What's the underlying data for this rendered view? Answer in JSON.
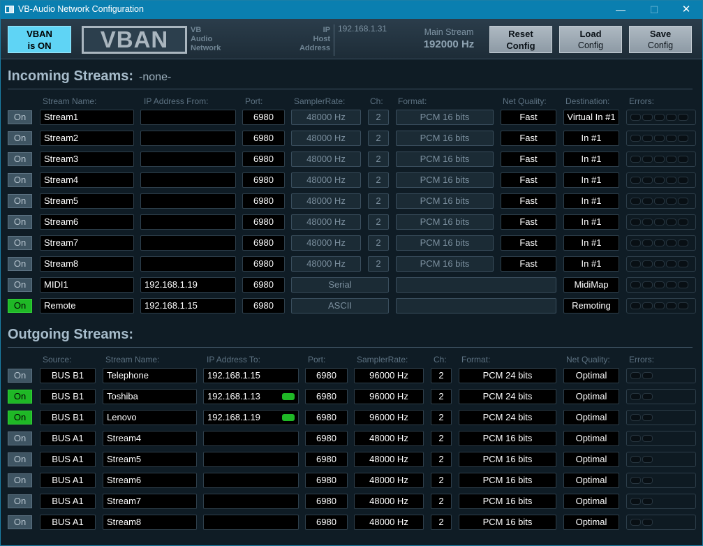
{
  "window": {
    "title": "VB-Audio Network Configuration",
    "min_glyph": "—",
    "max_glyph": "☐",
    "close_glyph": "✕"
  },
  "header": {
    "vban_on_line1": "VBAN",
    "vban_on_line2": "is ON",
    "logo": "VBAN",
    "sub1": "VB",
    "sub2": "Audio",
    "sub3": "Network",
    "ip_label": "IP",
    "host_label": "Host",
    "address_label": "Address",
    "ip_value": "192.168.1.31",
    "main_stream_label": "Main Stream",
    "main_stream_value": "192000 Hz",
    "reset_bold": "Reset",
    "reset_rest": "Config",
    "load_bold": "Load",
    "load_rest": "Config",
    "save_bold": "Save",
    "save_rest": "Config"
  },
  "incoming": {
    "title": "Incoming Streams:",
    "status": "-none-",
    "headers": {
      "name": "Stream Name:",
      "ip": "IP Address From:",
      "port": "Port:",
      "rate": "SamplerRate:",
      "ch": "Ch:",
      "format": "Format:",
      "quality": "Net Quality:",
      "dest": "Destination:",
      "errors": "Errors:"
    },
    "rows": [
      {
        "on": "On",
        "active": false,
        "name": "Stream1",
        "ip": "",
        "port": "6980",
        "rate": "48000 Hz",
        "ch": "2",
        "format": "PCM 16 bits",
        "quality": "Fast",
        "dest": "Virtual In #1"
      },
      {
        "on": "On",
        "active": false,
        "name": "Stream2",
        "ip": "",
        "port": "6980",
        "rate": "48000 Hz",
        "ch": "2",
        "format": "PCM 16 bits",
        "quality": "Fast",
        "dest": "In #1"
      },
      {
        "on": "On",
        "active": false,
        "name": "Stream3",
        "ip": "",
        "port": "6980",
        "rate": "48000 Hz",
        "ch": "2",
        "format": "PCM 16 bits",
        "quality": "Fast",
        "dest": "In #1"
      },
      {
        "on": "On",
        "active": false,
        "name": "Stream4",
        "ip": "",
        "port": "6980",
        "rate": "48000 Hz",
        "ch": "2",
        "format": "PCM 16 bits",
        "quality": "Fast",
        "dest": "In #1"
      },
      {
        "on": "On",
        "active": false,
        "name": "Stream5",
        "ip": "",
        "port": "6980",
        "rate": "48000 Hz",
        "ch": "2",
        "format": "PCM 16 bits",
        "quality": "Fast",
        "dest": "In #1"
      },
      {
        "on": "On",
        "active": false,
        "name": "Stream6",
        "ip": "",
        "port": "6980",
        "rate": "48000 Hz",
        "ch": "2",
        "format": "PCM 16 bits",
        "quality": "Fast",
        "dest": "In #1"
      },
      {
        "on": "On",
        "active": false,
        "name": "Stream7",
        "ip": "",
        "port": "6980",
        "rate": "48000 Hz",
        "ch": "2",
        "format": "PCM 16 bits",
        "quality": "Fast",
        "dest": "In #1"
      },
      {
        "on": "On",
        "active": false,
        "name": "Stream8",
        "ip": "",
        "port": "6980",
        "rate": "48000 Hz",
        "ch": "2",
        "format": "PCM 16 bits",
        "quality": "Fast",
        "dest": "In #1"
      },
      {
        "on": "On",
        "active": false,
        "name": "MIDI1",
        "ip": "192.168.1.19",
        "port": "6980",
        "mode": "Serial",
        "dest": "MidiMap"
      },
      {
        "on": "On",
        "active": true,
        "name": "Remote",
        "ip": "192.168.1.15",
        "port": "6980",
        "mode": "ASCII",
        "dest": "Remoting"
      }
    ]
  },
  "outgoing": {
    "title": "Outgoing Streams:",
    "headers": {
      "source": "Source:",
      "name": "Stream Name:",
      "ip": "IP Address To:",
      "port": "Port:",
      "rate": "SamplerRate:",
      "ch": "Ch:",
      "format": "Format:",
      "quality": "Net Quality:",
      "errors": "Errors:"
    },
    "rows": [
      {
        "on": "On",
        "active": false,
        "source": "BUS B1",
        "name": "Telephone",
        "ip": "192.168.1.15",
        "ip_led": false,
        "port": "6980",
        "rate": "96000 Hz",
        "ch": "2",
        "format": "PCM 24 bits",
        "quality": "Optimal"
      },
      {
        "on": "On",
        "active": true,
        "source": "BUS B1",
        "name": "Toshiba",
        "ip": "192.168.1.13",
        "ip_led": true,
        "port": "6980",
        "rate": "96000 Hz",
        "ch": "2",
        "format": "PCM 24 bits",
        "quality": "Optimal"
      },
      {
        "on": "On",
        "active": true,
        "source": "BUS B1",
        "name": "Lenovo",
        "ip": "192.168.1.19",
        "ip_led": true,
        "port": "6980",
        "rate": "96000 Hz",
        "ch": "2",
        "format": "PCM 24 bits",
        "quality": "Optimal"
      },
      {
        "on": "On",
        "active": false,
        "source": "BUS A1",
        "name": "Stream4",
        "ip": "",
        "ip_led": false,
        "port": "6980",
        "rate": "48000 Hz",
        "ch": "2",
        "format": "PCM 16 bits",
        "quality": "Optimal"
      },
      {
        "on": "On",
        "active": false,
        "source": "BUS A1",
        "name": "Stream5",
        "ip": "",
        "ip_led": false,
        "port": "6980",
        "rate": "48000 Hz",
        "ch": "2",
        "format": "PCM 16 bits",
        "quality": "Optimal"
      },
      {
        "on": "On",
        "active": false,
        "source": "BUS A1",
        "name": "Stream6",
        "ip": "",
        "ip_led": false,
        "port": "6980",
        "rate": "48000 Hz",
        "ch": "2",
        "format": "PCM 16 bits",
        "quality": "Optimal"
      },
      {
        "on": "On",
        "active": false,
        "source": "BUS A1",
        "name": "Stream7",
        "ip": "",
        "ip_led": false,
        "port": "6980",
        "rate": "48000 Hz",
        "ch": "2",
        "format": "PCM 16 bits",
        "quality": "Optimal"
      },
      {
        "on": "On",
        "active": false,
        "source": "BUS A1",
        "name": "Stream8",
        "ip": "",
        "ip_led": false,
        "port": "6980",
        "rate": "48000 Hz",
        "ch": "2",
        "format": "PCM 16 bits",
        "quality": "Optimal"
      }
    ]
  },
  "colors": {
    "accent": "#5fd4f5",
    "active": "#1fb826",
    "titlebar": "#0a7fb0"
  }
}
